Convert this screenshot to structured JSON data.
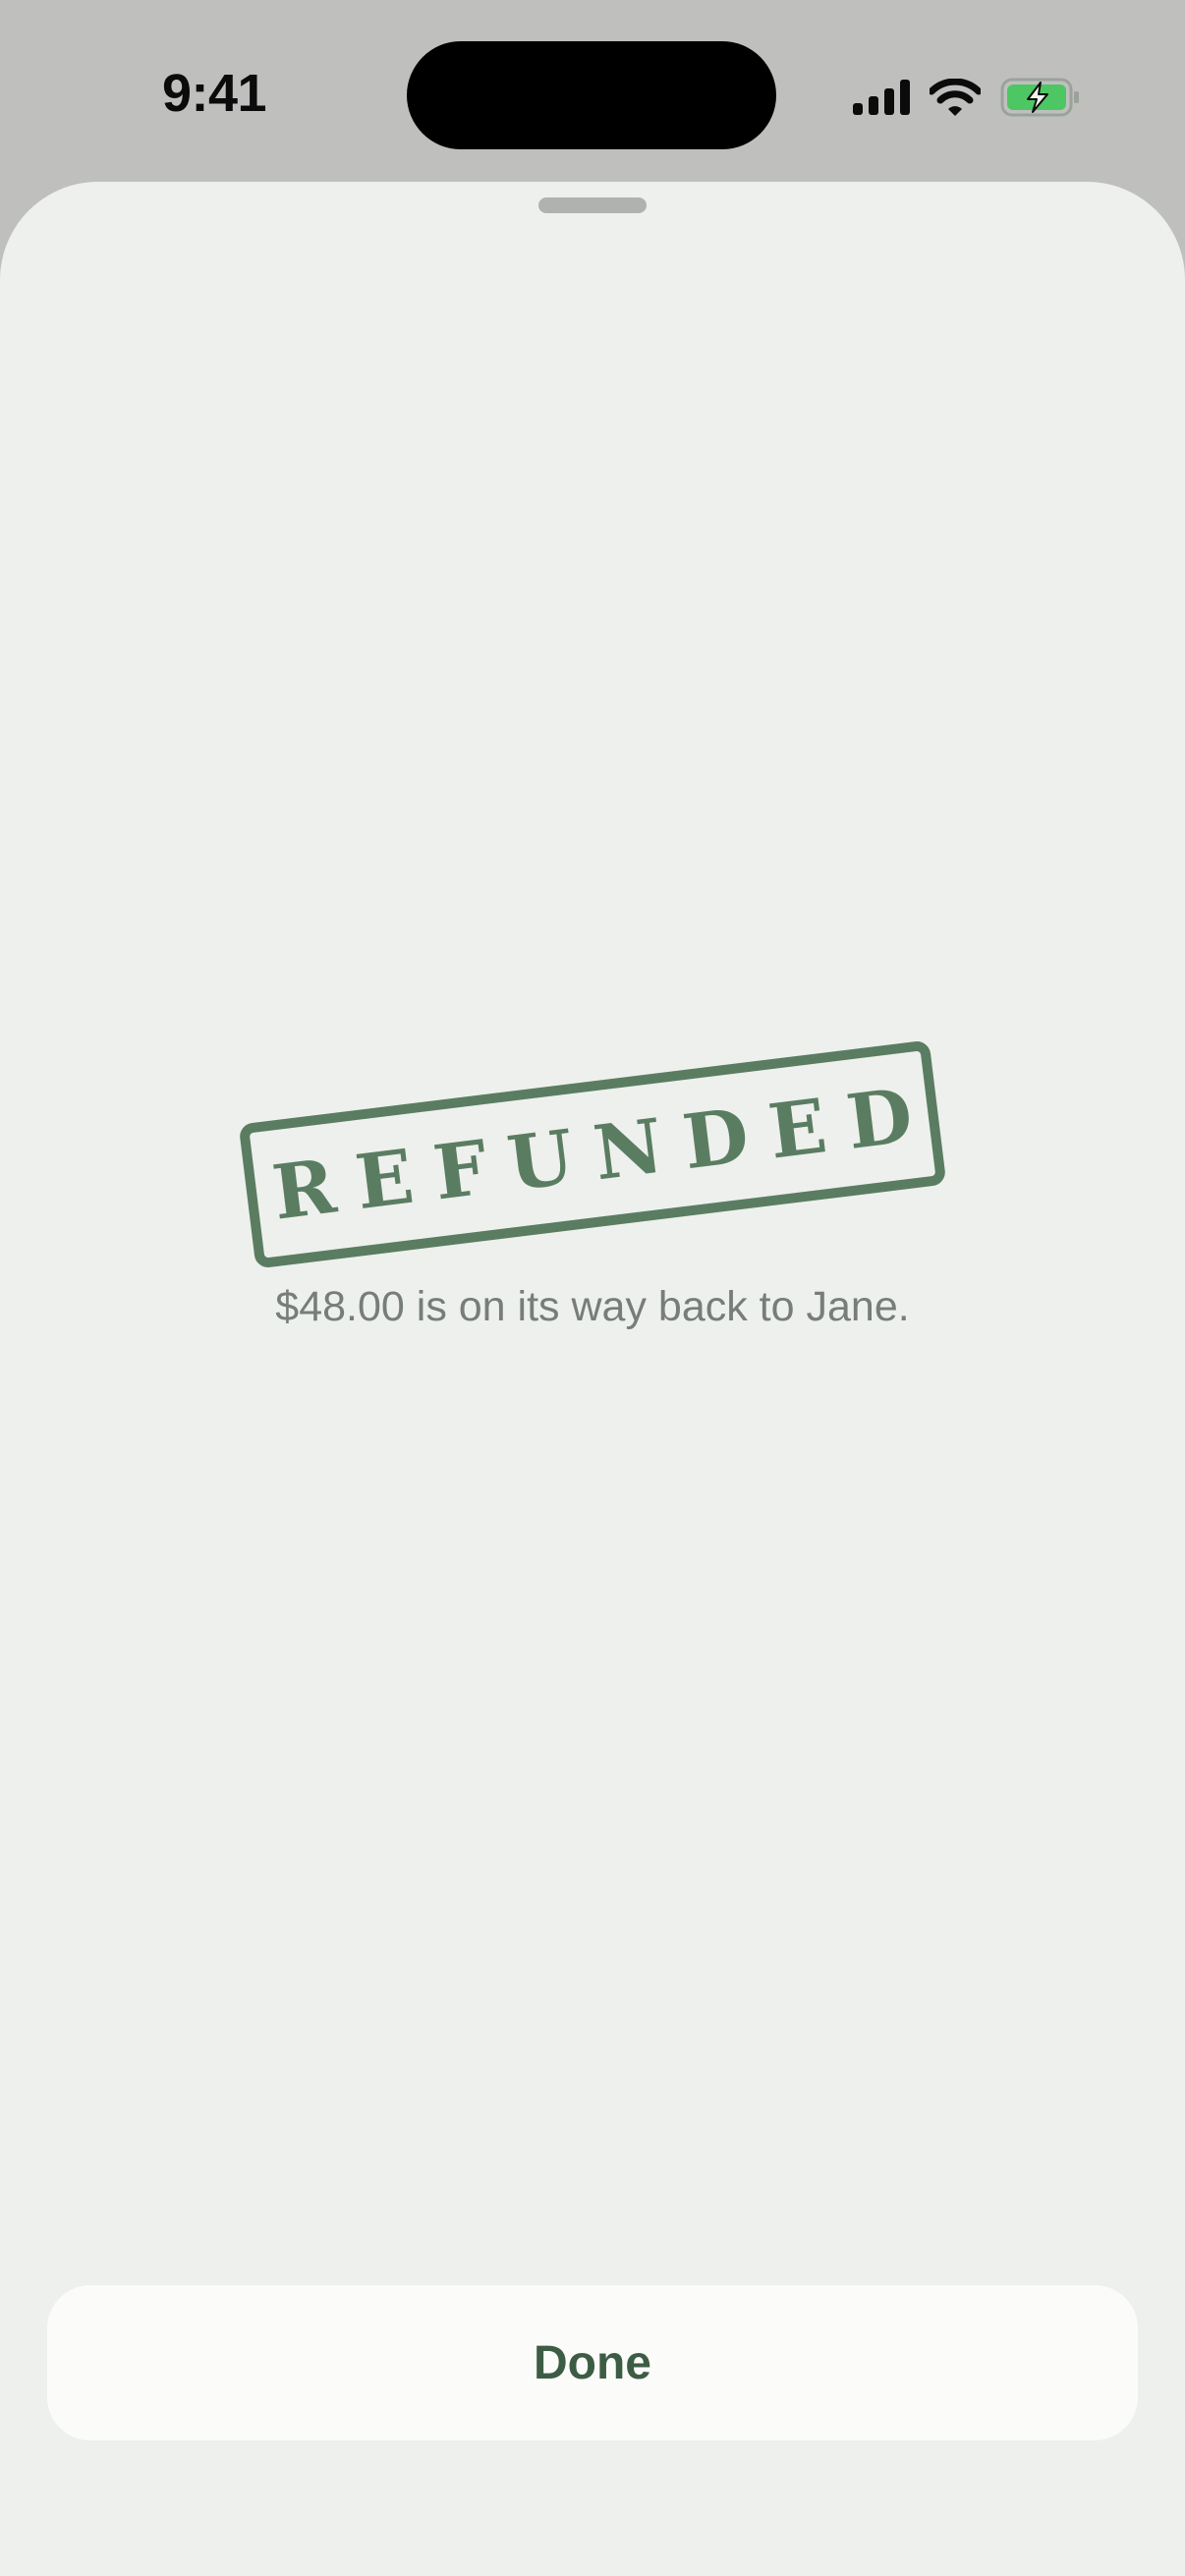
{
  "status_bar": {
    "time": "9:41",
    "signal_icon": "cellular-signal-icon",
    "wifi_icon": "wifi-icon",
    "battery_icon": "battery-charging-icon"
  },
  "sheet": {
    "stamp_text": "REFUNDED",
    "message": "$48.00 is on its way back to Jane.",
    "done_label": "Done"
  },
  "colors": {
    "accent": "#5a7d62",
    "button_text": "#3d5c45",
    "sheet_background": "#eef0ed",
    "backdrop": "#bfc0be",
    "battery_fill": "#4cc763"
  }
}
